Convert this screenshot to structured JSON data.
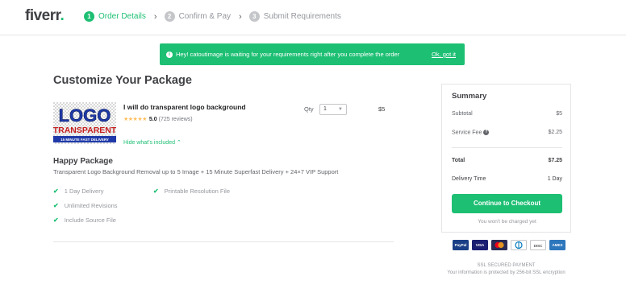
{
  "header": {
    "logo_text": "fiverr",
    "logo_dot": ".",
    "steps": [
      {
        "num": "1",
        "label": "Order Details"
      },
      {
        "num": "2",
        "label": "Confirm & Pay"
      },
      {
        "num": "3",
        "label": "Submit Requirements"
      }
    ],
    "step_separator": "›"
  },
  "banner": {
    "icon": "i",
    "message": "Hey! catoutimage is waiting for your requirements right after you complete the order",
    "dismiss_label": "Ok, got it"
  },
  "main": {
    "title": "Customize Your Package",
    "gig": {
      "thumb_line1": "LOGO",
      "thumb_line2": "TRANSPARENT",
      "thumb_line3": "15 MINUTE FAST DELIVERY",
      "title": "I will do transparent logo background",
      "stars": "★★★★★",
      "rating": "5.0",
      "reviews": "(725 reviews)",
      "hide_link": "Hide what's included ⌃"
    },
    "qty": {
      "label": "Qty",
      "value": "1",
      "caret": "▼"
    },
    "line_price": "$5",
    "package": {
      "name": "Happy Package",
      "description": "Transparent Logo Background Removal up to 5 Image + 15 Minute Superfast Delivery + 24×7 VIP Support",
      "features": [
        "1 Day Delivery",
        "Printable Resolution File",
        "Unlimited Revisions",
        "Include Source File"
      ],
      "check_icon": "✔"
    }
  },
  "summary": {
    "title": "Summary",
    "subtotal_label": "Subtotal",
    "subtotal_value": "$5",
    "service_fee_label": "Service Fee",
    "service_fee_value": "$2.25",
    "help_icon": "?",
    "total_label": "Total",
    "total_value": "$7.25",
    "delivery_label": "Delivery Time",
    "delivery_value": "1 Day",
    "checkout_label": "Continue to Checkout",
    "not_charged": "You won't be charged yet"
  },
  "payment": {
    "cards": [
      "PayPal",
      "VISA",
      "MC",
      "Diners",
      "DISC",
      "AMEX"
    ],
    "ssl_title": "SSL SECURED PAYMENT",
    "ssl_desc": "Your information is protected by 256-bit SSL encryption"
  },
  "colors": {
    "brand_green": "#1dbf73",
    "star_yellow": "#ffbe5b",
    "text_dark": "#404145",
    "text_muted": "#95979d"
  }
}
